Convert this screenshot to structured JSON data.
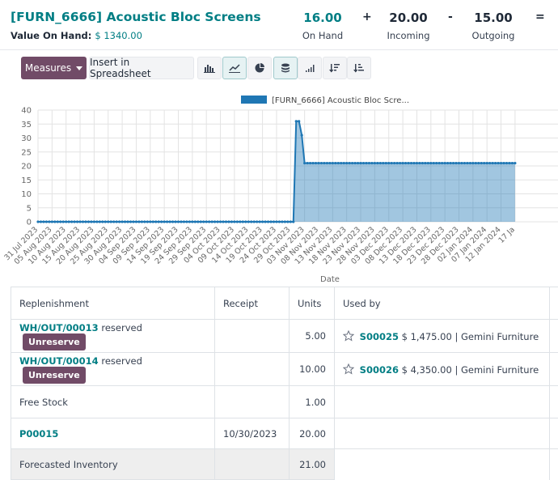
{
  "product": {
    "title": "[FURN_6666] Acoustic Bloc Screens",
    "value_label": "Value On Hand:",
    "value_amount": "$ 1340.00"
  },
  "stats": [
    {
      "value": "16.00",
      "label": "On Hand"
    },
    {
      "value": "20.00",
      "label": "Incoming"
    },
    {
      "value": "15.00",
      "label": "Outgoing"
    }
  ],
  "operators": [
    "+",
    "-",
    "="
  ],
  "toolbar": {
    "measures_label": "Measures",
    "insert_label": "Insert in Spreadsheet",
    "icons": [
      "bar-chart-icon",
      "line-chart-icon",
      "pie-chart-icon",
      "stacked-icon",
      "ascending-bars-icon",
      "sort-descending-icon",
      "sort-ascending-icon"
    ]
  },
  "chart_data": {
    "type": "area",
    "legend": [
      "[FURN_6666] Acoustic Bloc Scre..."
    ],
    "legend_color": "#1f77b4",
    "xlabel": "Date",
    "ylabel": "",
    "ylim": [
      0,
      40
    ],
    "yticks": [
      0,
      5,
      10,
      15,
      20,
      25,
      30,
      35,
      40
    ],
    "xticks": [
      "31 Jul 2023",
      "05 Aug 2023",
      "10 Aug 2023",
      "15 Aug 2023",
      "20 Aug 2023",
      "25 Aug 2023",
      "30 Aug 2023",
      "04 Sep 2023",
      "09 Sep 2023",
      "14 Sep 2023",
      "19 Sep 2023",
      "24 Sep 2023",
      "29 Sep 2023",
      "04 Oct 2023",
      "09 Oct 2023",
      "14 Oct 2023",
      "19 Oct 2023",
      "24 Oct 2023",
      "29 Oct 2023",
      "03 Nov 2023",
      "08 Nov 2023",
      "13 Nov 2023",
      "18 Nov 2023",
      "23 Nov 2023",
      "28 Nov 2023",
      "03 Dec 2023",
      "08 Dec 2023",
      "13 Dec 2023",
      "18 Dec 2023",
      "23 Dec 2023",
      "28 Dec 2023",
      "02 Jan 2024",
      "07 Jan 2024",
      "12 Jan 2024",
      "17 Ja"
    ],
    "series": [
      {
        "name": "[FURN_6666] Acoustic Bloc Screens",
        "points": [
          {
            "x": "2023-07-31",
            "y": 0
          },
          {
            "x": "2023-10-30",
            "y": 0
          },
          {
            "x": "2023-10-31",
            "y": 36
          },
          {
            "x": "2023-11-01",
            "y": 36
          },
          {
            "x": "2023-11-02",
            "y": 31
          },
          {
            "x": "2023-11-03",
            "y": 21
          },
          {
            "x": "2024-01-17",
            "y": 21
          }
        ]
      }
    ],
    "grid": true
  },
  "table": {
    "headers": [
      "Replenishment",
      "Receipt",
      "Units",
      "Used by"
    ],
    "rows": [
      {
        "ref": "WH/OUT/00013",
        "status": "reserved",
        "action": "Unreserve",
        "receipt": "",
        "units": "5.00",
        "order": "S00025",
        "amount": "$ 1,475.00",
        "partner": "| Gemini Furniture"
      },
      {
        "ref": "WH/OUT/00014",
        "status": "reserved",
        "action": "Unreserve",
        "receipt": "",
        "units": "10.00",
        "order": "S00026",
        "amount": "$ 4,350.00",
        "partner": "| Gemini Furniture"
      },
      {
        "ref": "Free Stock",
        "receipt": "",
        "units": "1.00"
      },
      {
        "ref": "P00015",
        "receipt": "10/30/2023",
        "units": "20.00"
      },
      {
        "ref": "Forecasted Inventory",
        "units": "21.00"
      }
    ]
  }
}
